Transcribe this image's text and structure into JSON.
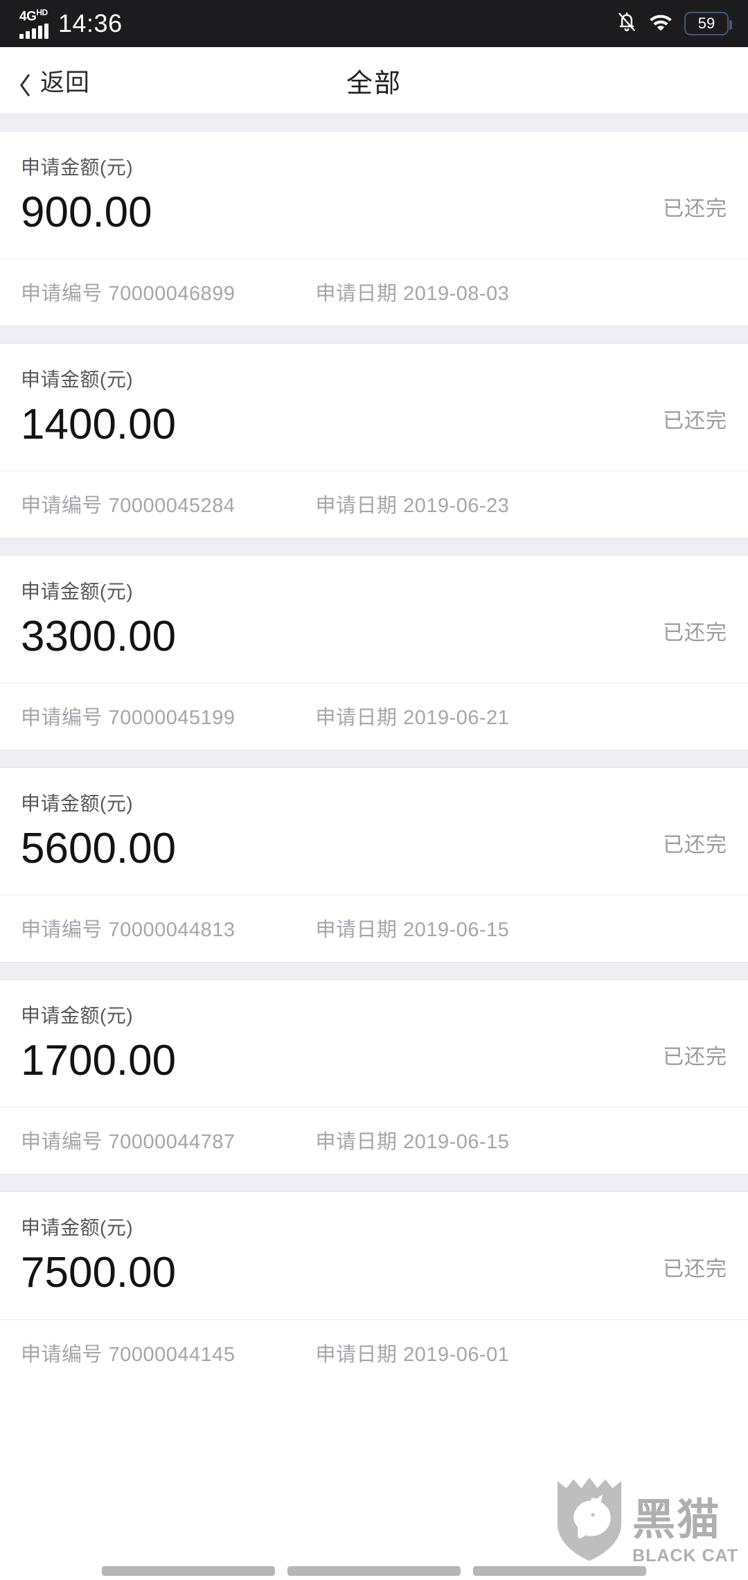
{
  "status_bar": {
    "network_label": "4G",
    "network_sup": "HD",
    "time": "14:36",
    "battery": "59",
    "icons": [
      "signal-bars-icon",
      "bell-off-icon",
      "wifi-icon",
      "battery-icon"
    ]
  },
  "nav": {
    "back_label": "返回",
    "title": "全部"
  },
  "labels": {
    "amount_label": "申请金额(元)",
    "number_prefix": "申请编号",
    "date_prefix": "申请日期"
  },
  "watermark": {
    "cn": "黑猫",
    "en": "BLACK CAT"
  },
  "colors": {
    "statusbar_bg": "#1c1c1e",
    "page_bg": "#ffffff",
    "gap_bg": "#eeeef4",
    "amount_text": "#131317",
    "label_text": "#58585e",
    "meta_text": "#a5a5ac",
    "status_text": "#9a9aa0"
  },
  "records": [
    {
      "amount": "900.00",
      "status": "已还完",
      "number": "70000046899",
      "date": "2019-08-03"
    },
    {
      "amount": "1400.00",
      "status": "已还完",
      "number": "70000045284",
      "date": "2019-06-23"
    },
    {
      "amount": "3300.00",
      "status": "已还完",
      "number": "70000045199",
      "date": "2019-06-21"
    },
    {
      "amount": "5600.00",
      "status": "已还完",
      "number": "70000044813",
      "date": "2019-06-15"
    },
    {
      "amount": "1700.00",
      "status": "已还完",
      "number": "70000044787",
      "date": "2019-06-15"
    },
    {
      "amount": "7500.00",
      "status": "已还完",
      "number": "70000044145",
      "date": "2019-06-01"
    }
  ]
}
